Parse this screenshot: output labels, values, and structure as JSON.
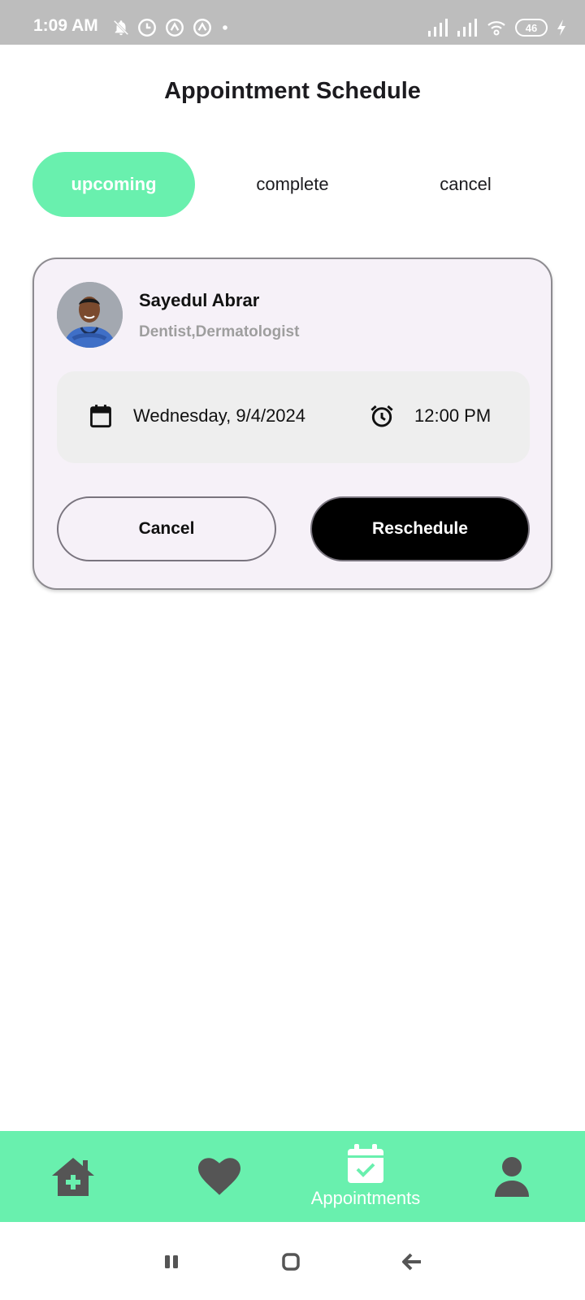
{
  "status_bar": {
    "time": "1:09 AM",
    "battery": "46",
    "icons": [
      "bell-off-icon",
      "clock-icon",
      "app-icon",
      "app-icon",
      "dot-icon",
      "signal-icon",
      "signal-icon",
      "wifi-icon",
      "battery-icon",
      "charging-icon"
    ]
  },
  "header": {
    "title": "Appointment Schedule"
  },
  "tabs": [
    {
      "label": "upcoming",
      "active": true
    },
    {
      "label": "complete",
      "active": false
    },
    {
      "label": "cancel",
      "active": false
    }
  ],
  "appointment": {
    "doctor_name": "Sayedul Abrar",
    "specialty": "Dentist,Dermatologist",
    "date": "Wednesday, 9/4/2024",
    "time": "12:00 PM",
    "cancel_label": "Cancel",
    "reschedule_label": "Reschedule"
  },
  "bottom_nav": {
    "items": [
      {
        "icon": "home-medical-icon",
        "label": ""
      },
      {
        "icon": "heart-icon",
        "label": ""
      },
      {
        "icon": "calendar-check-icon",
        "label": "Appointments",
        "active": true
      },
      {
        "icon": "person-icon",
        "label": ""
      }
    ]
  },
  "colors": {
    "accent": "#69f0ae",
    "card_bg": "#f6f1f8",
    "nav_icon": "#555555"
  }
}
